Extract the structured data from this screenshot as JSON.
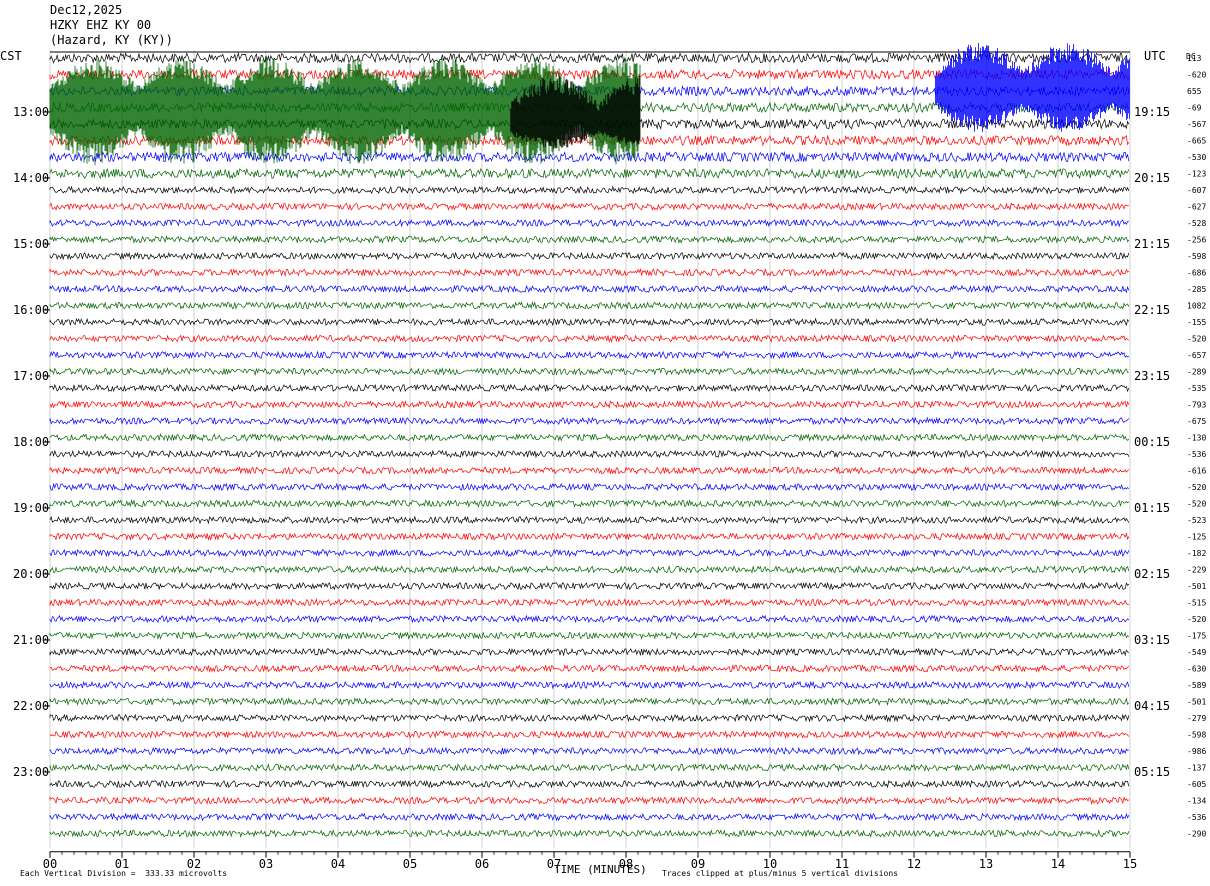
{
  "header": {
    "date": "Dec12,2025",
    "channel": "HZKY EHZ KY 00",
    "location": "(Hazard, KY (KY))",
    "left_tz": "CST",
    "right_tz": "UTC",
    "dc_label": "DC"
  },
  "footer": {
    "scale_note": "Each Vertical Division =  333.33 microvolts",
    "clip_note": "Traces clipped at plus/minus 5 vertical divisions",
    "xlabel": "TIME (MINUTES)"
  },
  "chart_data": {
    "type": "helicorder",
    "trace_colors": [
      "#000000",
      "#ff0000",
      "#0000ff",
      "#006400"
    ],
    "x_range_minutes": [
      0,
      15
    ],
    "x_ticks": [
      "00",
      "01",
      "02",
      "03",
      "04",
      "05",
      "06",
      "07",
      "08",
      "09",
      "10",
      "11",
      "12",
      "13",
      "14",
      "15"
    ],
    "rows_per_hour": 4,
    "row_minutes": 15,
    "left_hour_labels": [
      "13:00",
      "14:00",
      "15:00",
      "16:00",
      "17:00",
      "18:00",
      "19:00",
      "20:00",
      "21:00",
      "22:00",
      "23:00"
    ],
    "right_hour_labels": [
      "19:15",
      "20:15",
      "21:15",
      "22:15",
      "23:15",
      "00:15",
      "01:15",
      "02:15",
      "03:15",
      "04:15",
      "05:15"
    ],
    "dc_offsets": [
      "113",
      "-620",
      "655",
      "-69",
      "-567",
      "-665",
      "-530",
      "-123",
      "-607",
      "-627",
      "-528",
      "-256",
      "-598",
      "-686",
      "-285",
      "1082",
      "-155",
      "-520",
      "-657",
      "-289",
      "-535",
      "-793",
      "-675",
      "-130",
      "-536",
      "-616",
      "-520",
      "-520",
      "-523",
      "-125",
      "-182",
      "-229",
      "-501",
      "-515",
      "-520",
      "-175",
      "-549",
      "-630",
      "-589",
      "-501",
      "-279",
      "-598",
      "-986",
      "-137",
      "-605",
      "-134",
      "-536",
      "-290"
    ],
    "events": [
      {
        "label": "large event, green trace",
        "start_min": 0.0,
        "end_min": 8.2
      },
      {
        "label": "large event, black trace",
        "start_min": 6.4,
        "end_min": 8.2
      },
      {
        "label": "large event, blue trace",
        "start_min": 12.3,
        "end_min": 15.0
      }
    ],
    "clip_divisions": 5
  }
}
